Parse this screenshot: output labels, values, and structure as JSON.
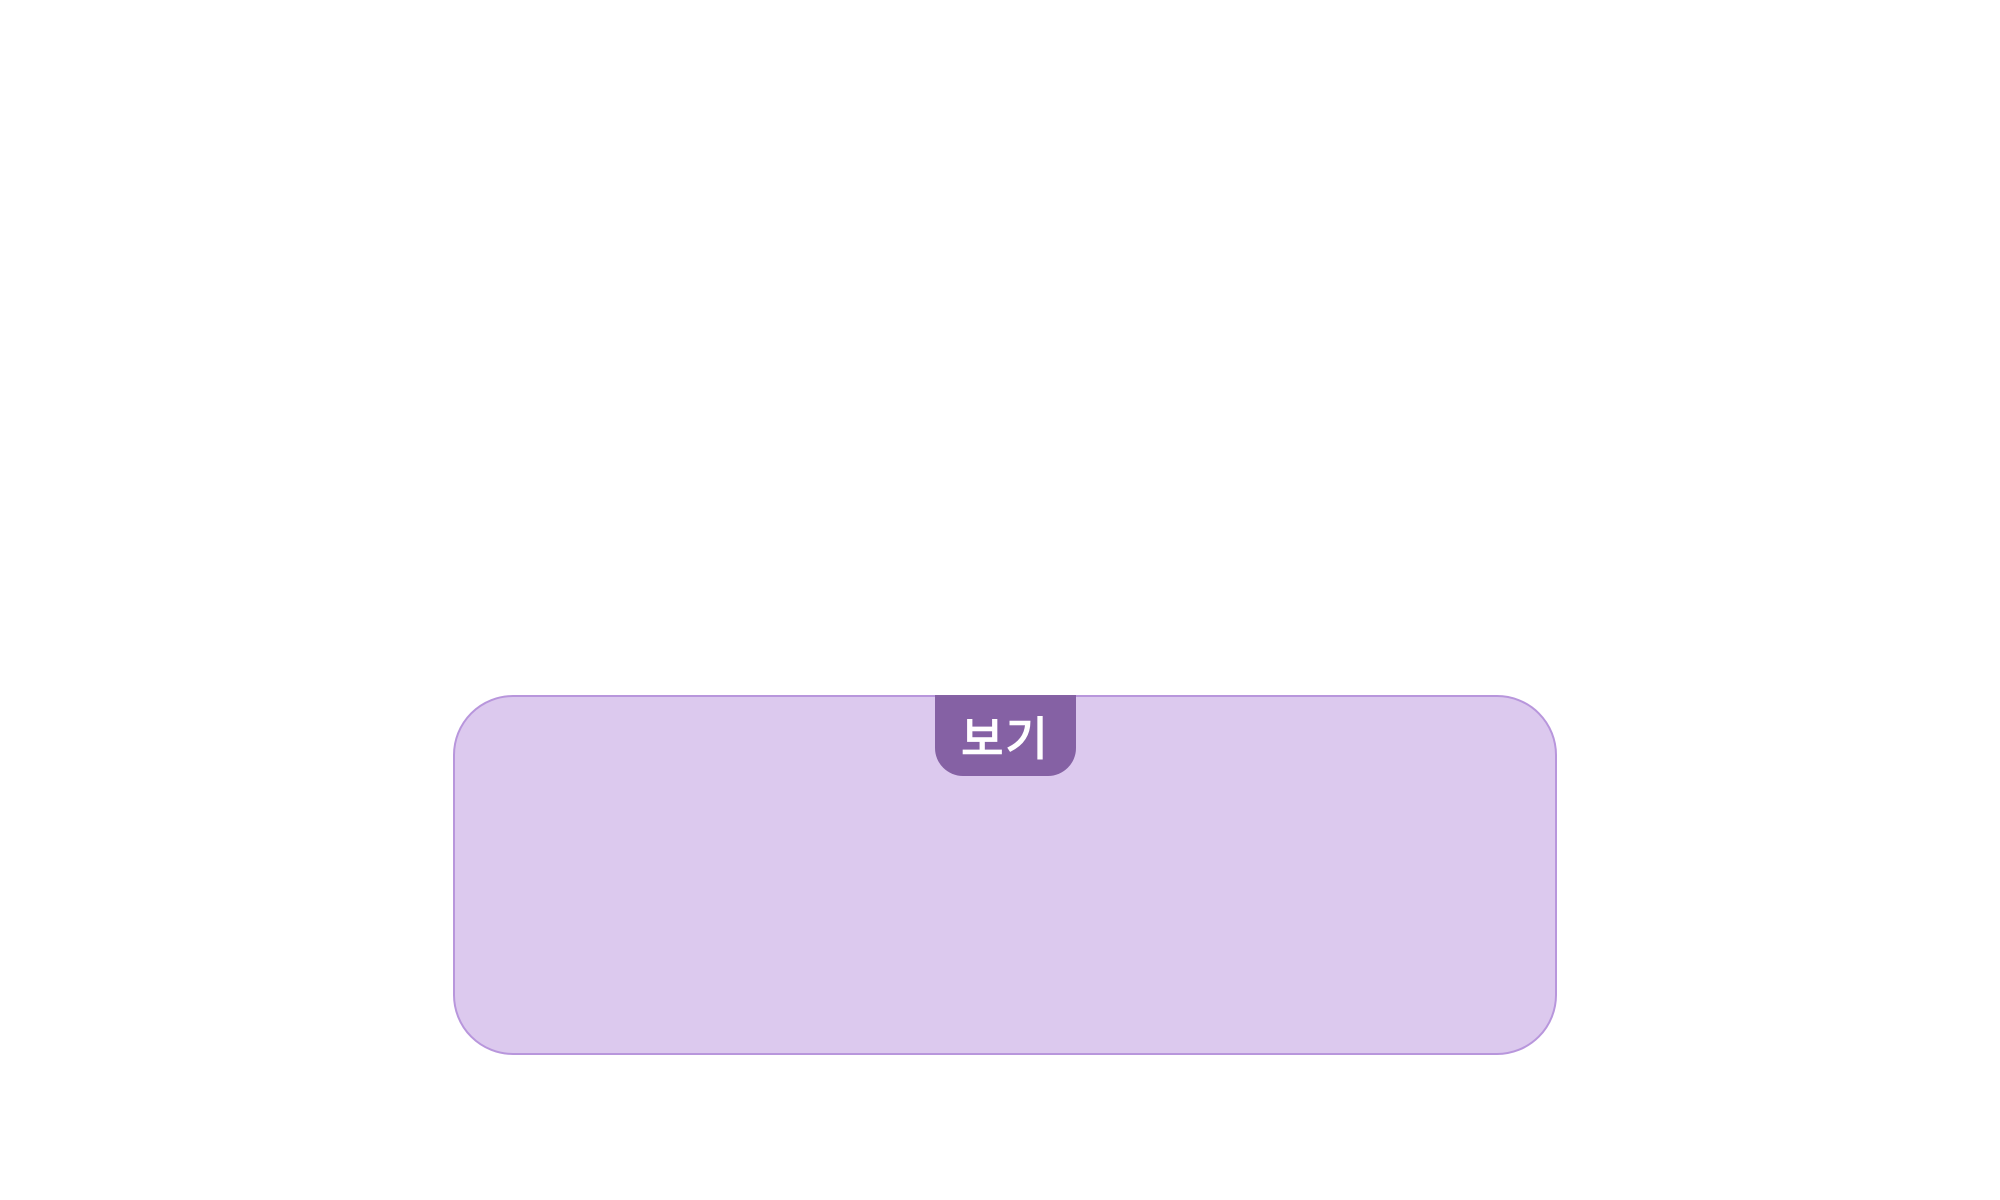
{
  "view_panel": {
    "tab_label": "보기",
    "colors": {
      "panel_fill": "#dcc9ee",
      "panel_border": "#b896dc",
      "tab_fill": "#8561a4",
      "tab_text": "#ffffff"
    }
  }
}
